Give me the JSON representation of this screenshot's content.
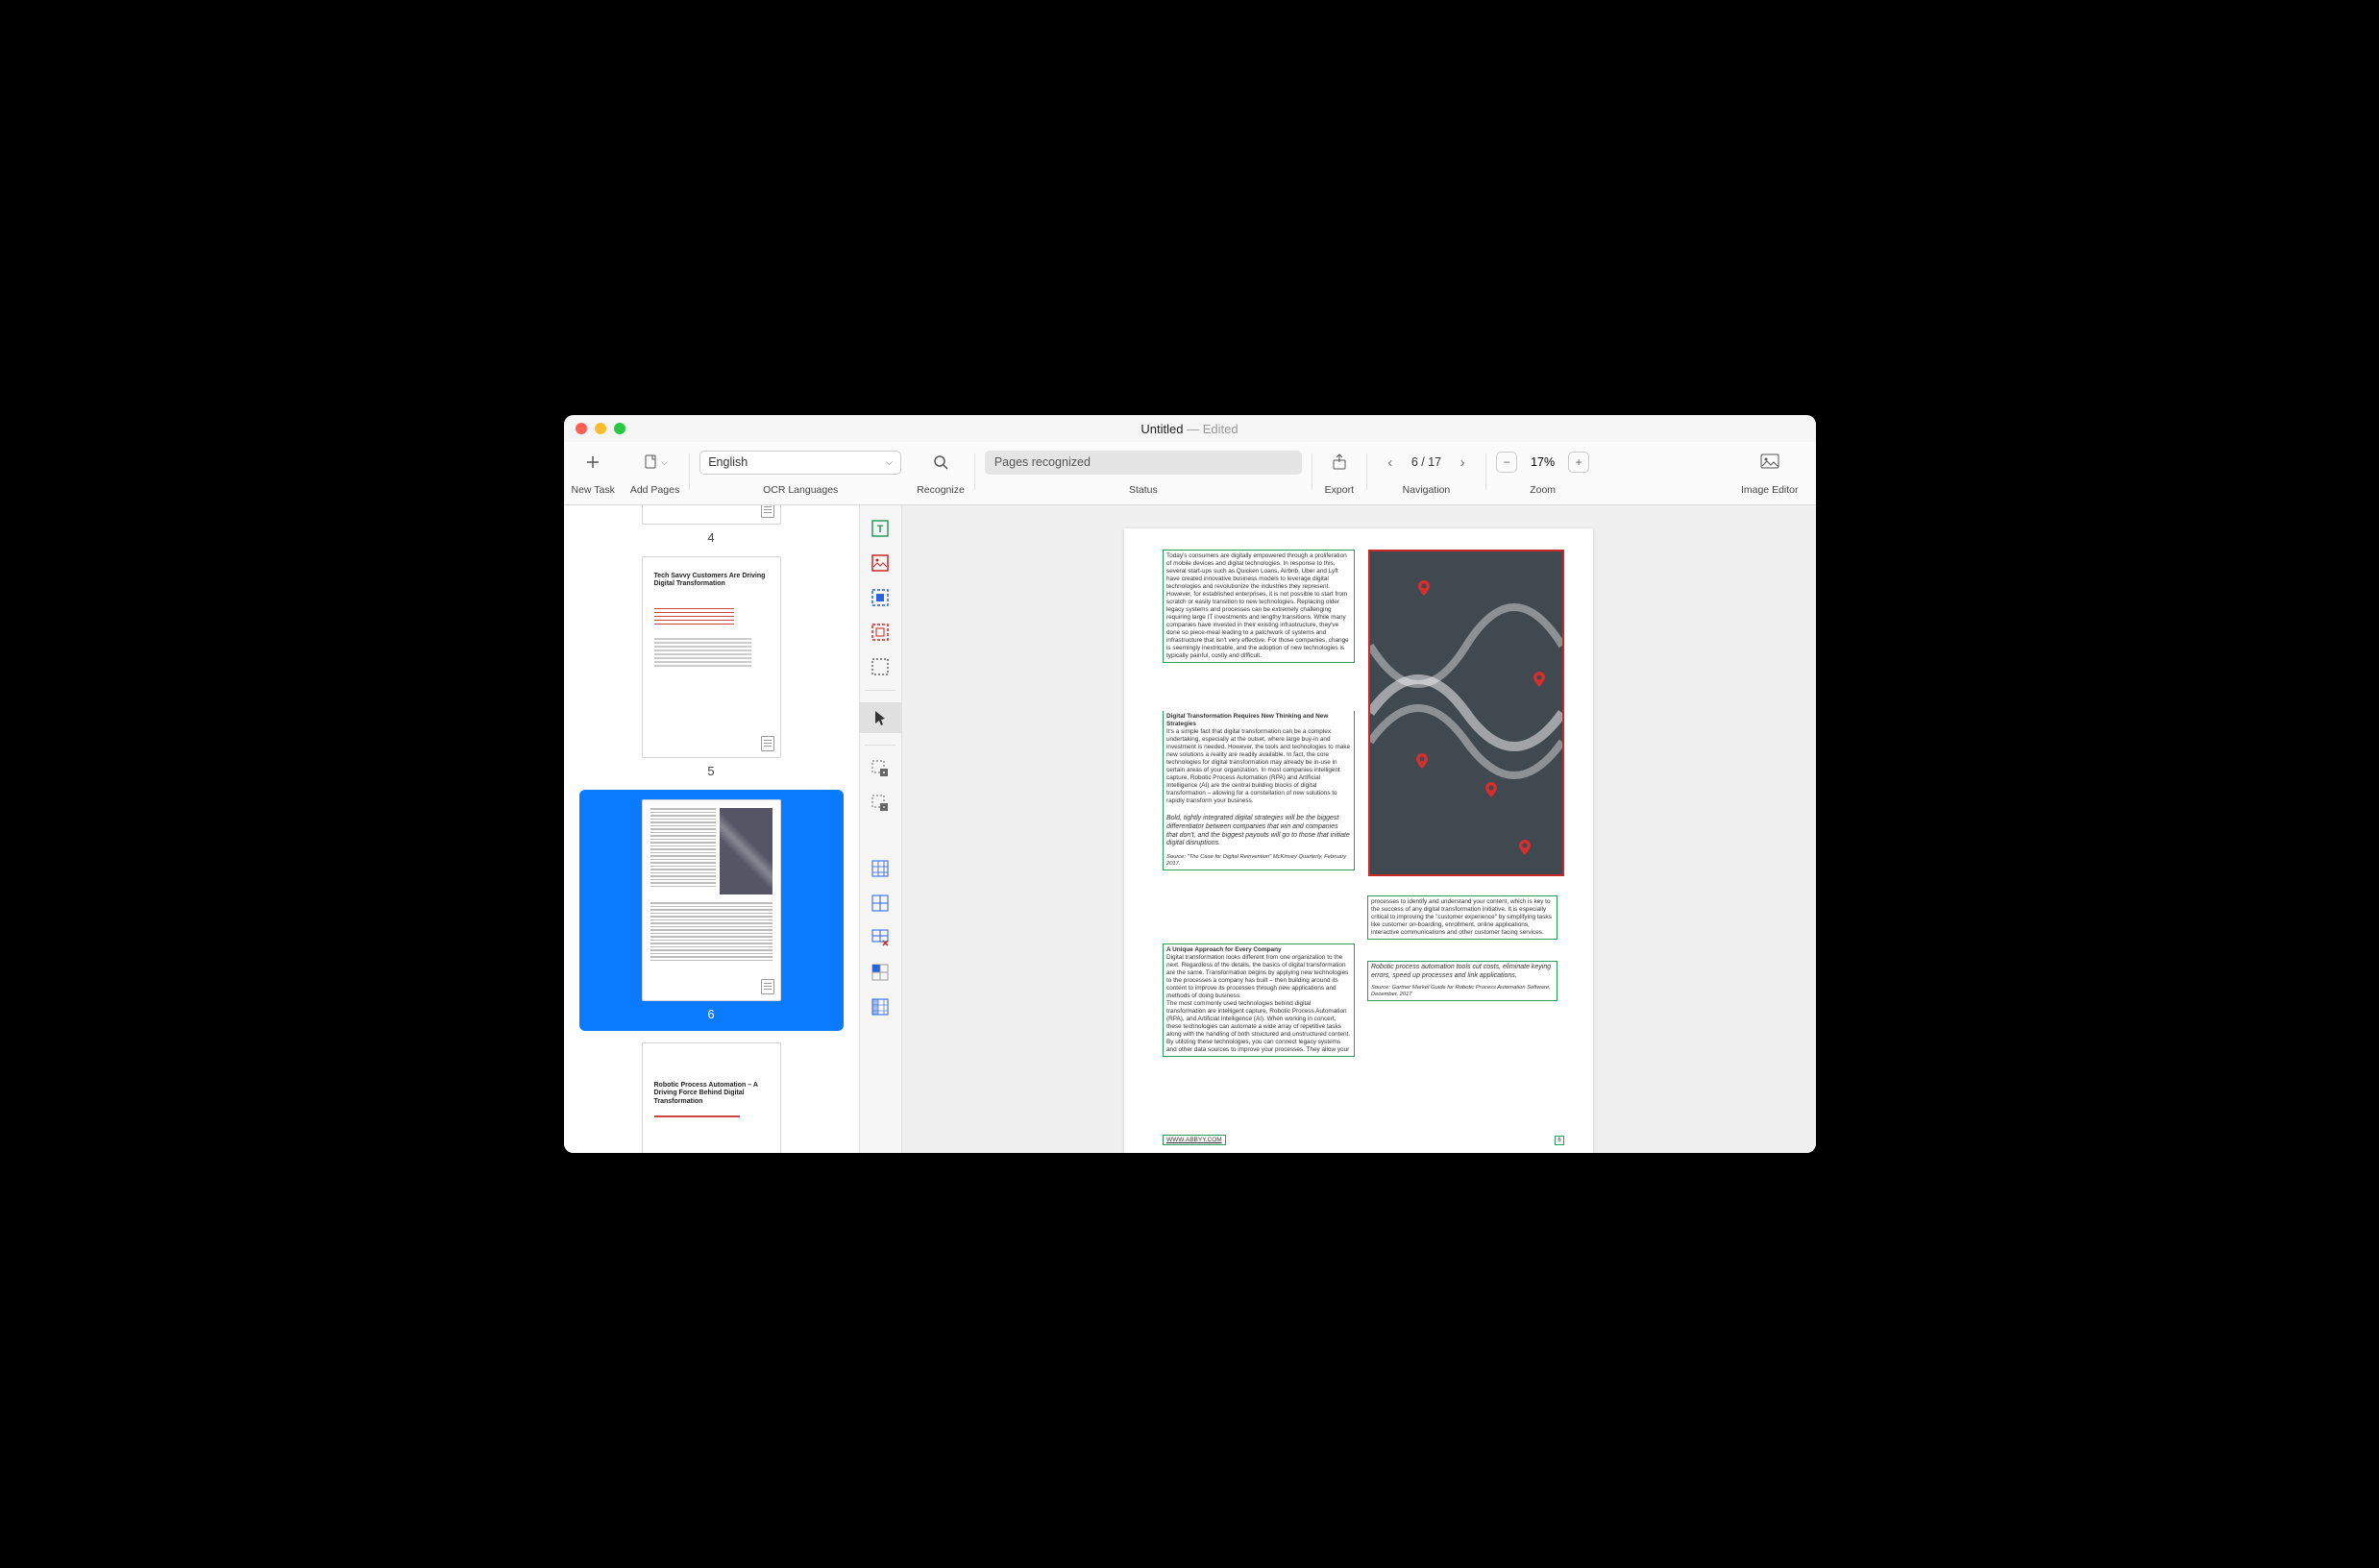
{
  "title": {
    "name": "Untitled",
    "status": "Edited"
  },
  "toolbar": {
    "new_task": "New Task",
    "add_pages": "Add Pages",
    "ocr_languages": "OCR Languages",
    "lang_value": "English",
    "recognize": "Recognize",
    "status": "Status",
    "status_value": "Pages recognized",
    "export": "Export",
    "navigation": "Navigation",
    "nav_page": "6 / 17",
    "zoom": "Zoom",
    "zoom_value": "17%",
    "image_editor": "Image Editor"
  },
  "thumbs": {
    "p4": "4",
    "p5": "5",
    "p5_title": "Tech Savvy Customers Are Driving Digital Transformation",
    "p6": "6",
    "p7_title": "Robotic Process Automation – A Driving Force Behind Digital Transformation"
  },
  "doc": {
    "block1": "Today's consumers are digitally empowered through a proliferation of mobile devices and digital technologies. In response to this, several start-ups such as Quicken Loans, Airbnb, Uber and Lyft have created innovative business models to leverage digital technologies and revolutionize the industries they represent.\nHowever, for established enterprises, it is not possible to start from scratch or easily transition to new technologies. Replacing older legacy systems and processes can be extremely challenging requiring large IT investments and lengthy transitions. While many companies have invested in their existing infrastructure, they've done so piece-meal leading to a patchwork of systems and infrastructure that isn't very effective. For those companies, change is seemingly inextricable, and the adoption of new technologies is typically painful, costly and difficult.",
    "block2_h": "Digital Transformation Requires New Thinking and New Strategies",
    "block2": "It's a simple fact that digital transformation can be a complex undertaking, especially at the outset, where large buy-in and investment is needed. However, the tools and technologies to make new solutions a reality are readily available. In fact, the core technologies for digital transformation may already be in-use in certain areas of your organization. In most companies intelligent capture, Robotic Process Automation (RPA) and Artificial Intelligence (AI) are the central building blocks of digital transformation – allowing for a constellation of new solutions to rapidly transform your business.",
    "quote1": "Bold, tightly integrated digital strategies will be the biggest differentiator between companies that win and companies that don't, and the biggest payouts will go to those that initiate digital disruptions.",
    "source1": "Source: \"The Case for Digital Reinvention\" McKinsey Quarterly, February 2017.",
    "block3_h": "A Unique Approach for Every Company",
    "block3": "Digital transformation looks different from one organization to the next. Regardless of the details, the basics of digital transformation are the same. Transformation begins by applying new technologies to the processes a company has built – then building around its content to improve its processes through new applications and methods of doing business.\nThe most commonly used technologies behind digital transformation are intelligent capture, Robotic Process Automation (RPA), and Artificial Intelligence (AI). When working in concert, these technologies can automate a wide array of repetitive tasks along with the handling of both structured and unstructured content. By utilizing these technologies, you can connect legacy systems and other data sources to improve your processes. They allow your",
    "block4": "processes to identify and understand your content, which is key to the success of any digital transformation initiative. It is especially critical to improving the \"customer experience\" by simplifying tasks like customer on-boarding, enrollment, online applications, interactive communications and other customer facing services.",
    "quote2": "Robotic process automation tools cut costs, eliminate keying errors, speed up processes and link applications.",
    "source2": "Source: Gartner Market Guide for Robotic Process Automation Software, December, 2017",
    "footer_url": "WWW.ABBYY.COM",
    "footer_pn": "6"
  }
}
